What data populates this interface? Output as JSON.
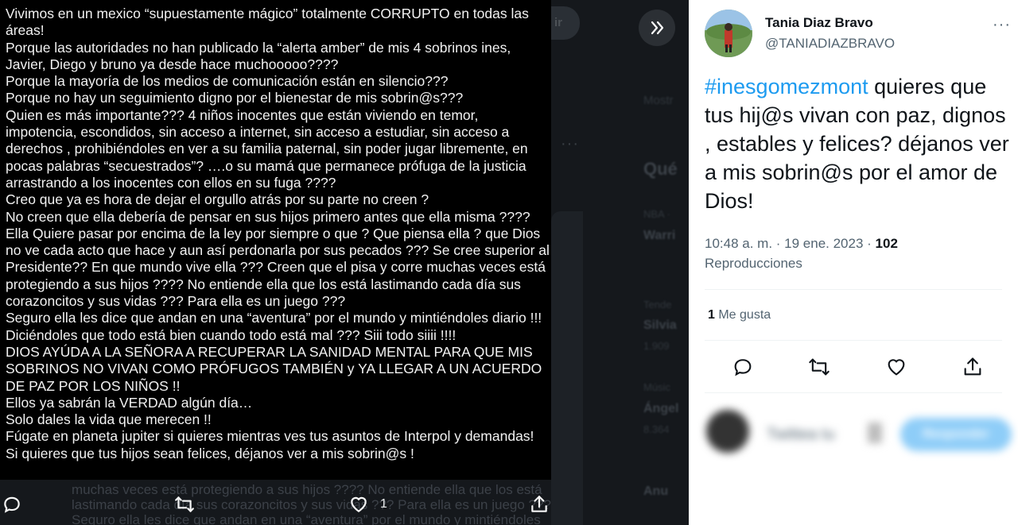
{
  "image_text": "Vivimos en un mexico “supuestamente mágico” totalmente CORRUPTO en todas las áreas!\nPorque las autoridades no han publicado la “alerta amber” de mis 4 sobrinos ines, Javier, Diego y bruno ya desde hace muchooooo????\nPorque la mayoría de los medios de comunicación están en silencio???\nPorque no hay un seguimiento digno por el bienestar de mis sobrin@s???\nQuien es más importante??? 4 niños inocentes que están viviendo en temor, impotencia, escondidos, sin acceso a internet, sin acceso a estudiar, sin acceso a derechos , prohibiéndoles en ver a su familia paternal, sin poder jugar libremente, en pocas palabras “secuestrados”? ….o su mamá que permanece prófuga de la justicia arrastrando a los inocentes con ellos en su fuga ????\nCreo que ya es hora de dejar el orgullo atrás por su parte no creen ?\nNo creen que ella debería de pensar en sus hijos primero antes que ella misma ????\nElla Quiere pasar por encima de la ley por siempre o que ? Que piensa ella ? que Dios no ve cada acto que hace y aun así perdonarla por sus pecados ??? Se cree superior al Presidente?? En que mundo vive ella ??? Creen que el pisa y corre muchas veces está protegiendo a sus hijos ???? No entiende ella que los está lastimando cada día sus corazoncitos y sus vidas ??? Para ella es un juego ???\nSeguro ella les dice que andan en una “aventura” por el mundo y mintiéndoles diario !!! Diciéndoles que todo está bien cuando todo está mal ??? Siii todo siiii !!!!\nDIOS AYÚDA A LA SEÑORA A RECUPERAR LA SANIDAD MENTAL PARA QUE MIS SOBRINOS NO VIVAN COMO PRÓFUGOS TAMBIÉN y YA LLEGAR A UN ACUERDO DE PAZ POR LOS NIÑOS !!\nEllos ya sabrán la VERDAD algún día…\nSolo dales la vida que merecen !!\nFúgate en planeta jupiter si quieres mientras ves tus asuntos de Interpol y demandas! Si quieres que tus hijos sean felices, déjanos ver a mis sobrin@s !",
  "ghost_text": {
    "line1": "muchas veces está protegiendo a sus hijos ???? No entiende ella que los está",
    "line2": "lastimando cada día sus corazoncitos y sus vidas ??? Para ella es un juego ???",
    "line3": "Seguro ella les dice que andan en una “aventura” por el mundo y mintiéndoles"
  },
  "image_actions": {
    "like_count": "1"
  },
  "background_sidebar": {
    "heading": "Qué",
    "item1_cat": "NBA ·",
    "item1_title": "Warri",
    "item2_cat": "Tende",
    "item2_title": "Silvia",
    "item2_count": "1.909",
    "item3_cat": "Músic",
    "item3_title": "Ángel",
    "item3_count": "8.364",
    "item4_title": "Anu",
    "show_more": "Mostr",
    "follow_btn": "ir"
  },
  "tweet": {
    "author_name": "Tania Diaz Bravo",
    "author_handle": "@TANIADIAZBRAVO",
    "hashtag": "#inesgomezmont",
    "body": " quieres que tus hij@s vivan con paz, dignos , estables y felices? déjanos ver a mis sobrin@s por el amor de Dios!",
    "time": "10:48 a. m. · 19 ene. 2023 · ",
    "views": "102",
    "views_label": "Reproducciones",
    "likes_count": "1",
    "likes_label": " Me gusta"
  },
  "reply": {
    "placeholder": "Twittea tu",
    "button": "Responder"
  },
  "colors": {
    "accent": "#1d9bf0",
    "text": "#0f1419",
    "secondary": "#536471"
  }
}
